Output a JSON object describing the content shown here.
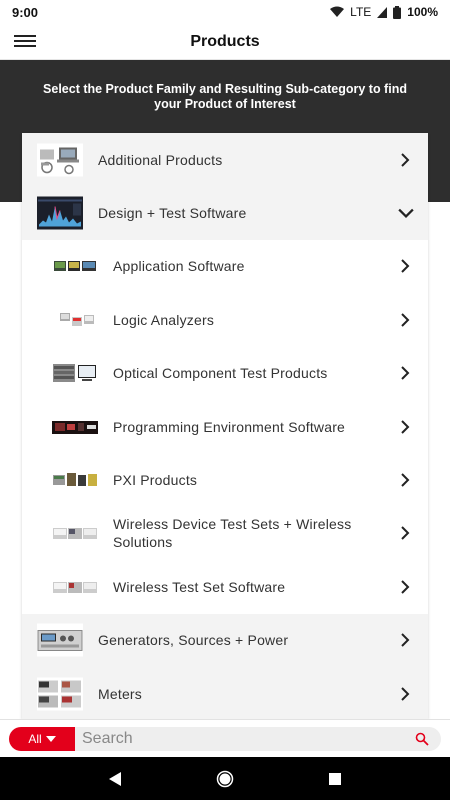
{
  "status_bar": {
    "time": "9:00",
    "network": "LTE",
    "battery": "100%"
  },
  "app_bar": {
    "title": "Products",
    "menu_icon": "hamburger-menu-icon"
  },
  "hero": {
    "intro_text": "Select the Product Family and Resulting Sub-category to find your Product of Interest"
  },
  "families": [
    {
      "label": "Additional Products",
      "expanded": false
    },
    {
      "label": "Design + Test Software",
      "expanded": true,
      "subcategories": [
        {
          "label": "Application Software"
        },
        {
          "label": "Logic Analyzers"
        },
        {
          "label": "Optical Component Test Products"
        },
        {
          "label": "Programming Environment Software"
        },
        {
          "label": "PXI Products"
        },
        {
          "label": "Wireless Device Test Sets + Wireless Solutions"
        },
        {
          "label": "Wireless Test Set Software"
        }
      ]
    },
    {
      "label": "Generators, Sources + Power",
      "expanded": false
    },
    {
      "label": "Meters",
      "expanded": false
    }
  ],
  "search": {
    "filter_label": "All",
    "placeholder": "Search",
    "accent": "#e3001b"
  },
  "colors": {
    "hero_bg": "#2e2e2e",
    "family_row_bg": "#f3f3f3"
  }
}
